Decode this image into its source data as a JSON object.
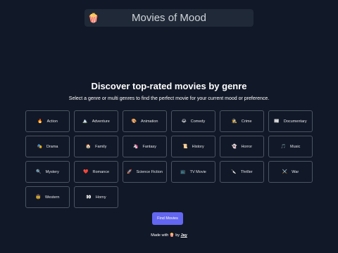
{
  "header": {
    "logo_icon": "🍿",
    "title": "Movies of Mood"
  },
  "main": {
    "heading": "Discover top-rated movies by genre",
    "subtitle": "Select a genre or multi genres to find the perfect movie for your current mood or preference."
  },
  "genres": [
    {
      "label": "Action",
      "icon": "🔥"
    },
    {
      "label": "Adventure",
      "icon": "🏔️"
    },
    {
      "label": "Animation",
      "icon": "🎨"
    },
    {
      "label": "Comedy",
      "icon": "😂"
    },
    {
      "label": "Crime",
      "icon": "🕵️"
    },
    {
      "label": "Documentary",
      "icon": "📰"
    },
    {
      "label": "Drama",
      "icon": "🎭"
    },
    {
      "label": "Family",
      "icon": "🏠"
    },
    {
      "label": "Fantasy",
      "icon": "🦄"
    },
    {
      "label": "History",
      "icon": "📜"
    },
    {
      "label": "Horror",
      "icon": "👻"
    },
    {
      "label": "Music",
      "icon": "🎵"
    },
    {
      "label": "Mystery",
      "icon": "🔍"
    },
    {
      "label": "Romance",
      "icon": "❤️"
    },
    {
      "label": "Science Fiction",
      "icon": "🚀"
    },
    {
      "label": "TV Movie",
      "icon": "📺"
    },
    {
      "label": "Thriller",
      "icon": "🔪"
    },
    {
      "label": "War",
      "icon": "⚔️"
    },
    {
      "label": "Western",
      "icon": "🤠"
    },
    {
      "label": "Horny",
      "icon": "👀"
    }
  ],
  "actions": {
    "find_label": "Find Movies"
  },
  "footer": {
    "prefix": "Made with",
    "icon": "🍿",
    "by": "by",
    "author": "Jay"
  },
  "colors": {
    "background": "#111827",
    "accent": "#6366f1",
    "tile_border": "#4b5563",
    "header_bg": "#1f2937"
  }
}
